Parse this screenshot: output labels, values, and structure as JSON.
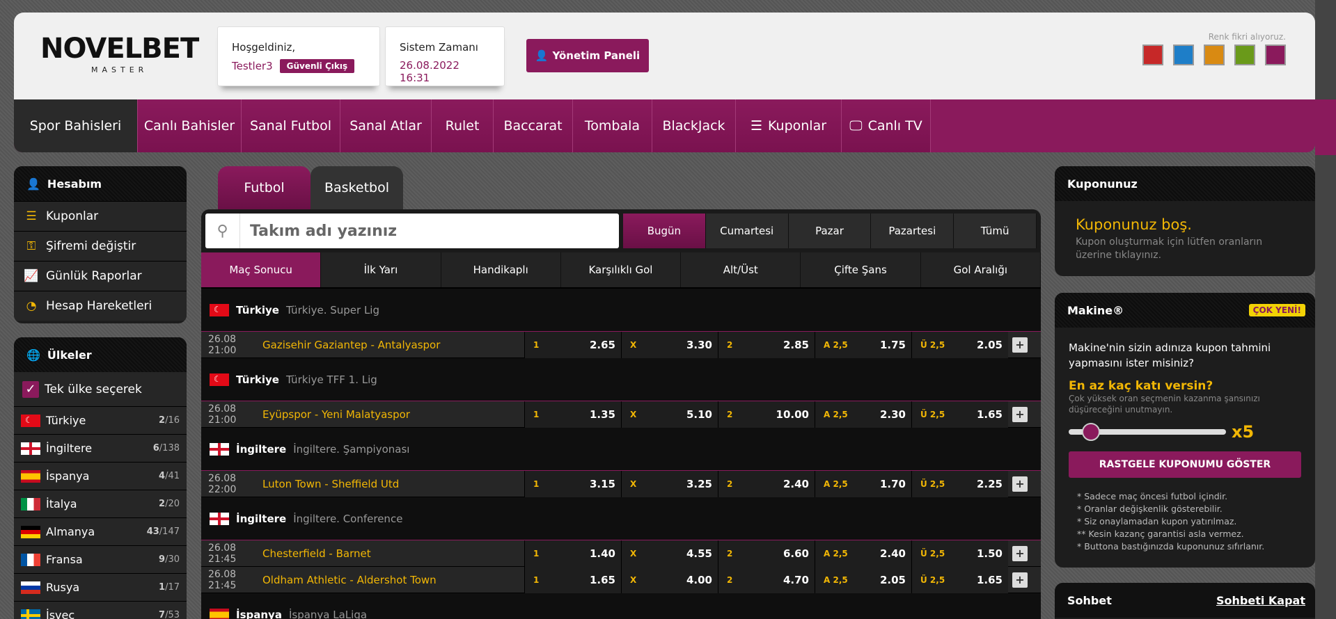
{
  "brand": {
    "name": "NOVELBET",
    "sub": "MASTER"
  },
  "header": {
    "welcome_label": "Hoşgeldiniz,",
    "username": "Testler3",
    "logout": "Güvenli Çıkış",
    "time_label": "Sistem Zamanı",
    "time_value": "26.08.2022 16:31",
    "panel_button": "Yönetim Paneli",
    "color_label": "Renk fikri alıyoruz.",
    "swatches": [
      "#c62828",
      "#1e7ec8",
      "#d98a12",
      "#6a9a1a",
      "#8a1a5c"
    ]
  },
  "nav": [
    {
      "label": "Spor Bahisleri",
      "active": true
    },
    {
      "label": "Canlı Bahisler"
    },
    {
      "label": "Sanal Futbol"
    },
    {
      "label": "Sanal Atlar"
    },
    {
      "label": "Rulet"
    },
    {
      "label": "Baccarat"
    },
    {
      "label": "Tombala"
    },
    {
      "label": "BlackJack"
    },
    {
      "label": "Kuponlar"
    },
    {
      "label": "Canlı TV"
    }
  ],
  "account": {
    "title": "Hesabım",
    "items": [
      "Kuponlar",
      "Şifremi değiştir",
      "Günlük Raporlar",
      "Hesap Hareketleri"
    ]
  },
  "countries": {
    "title": "Ülkeler",
    "single_select": "Tek ülke seçerek",
    "list": [
      {
        "name": "Türkiye",
        "a": "2",
        "b": "/16"
      },
      {
        "name": "İngiltere",
        "a": "6",
        "b": "/138"
      },
      {
        "name": "İspanya",
        "a": "4",
        "b": "/41"
      },
      {
        "name": "İtalya",
        "a": "2",
        "b": "/20"
      },
      {
        "name": "Almanya",
        "a": "43",
        "b": "/147"
      },
      {
        "name": "Fransa",
        "a": "9",
        "b": "/30"
      },
      {
        "name": "Rusya",
        "a": "1",
        "b": "/17"
      },
      {
        "name": "İsveç",
        "a": "7",
        "b": "/53"
      }
    ]
  },
  "sports": [
    "Futbol",
    "Basketbol"
  ],
  "search": {
    "placeholder": "Takım adı yazınız"
  },
  "days": [
    "Bugün",
    "Cumartesi",
    "Pazar",
    "Pazartesi",
    "Tümü"
  ],
  "markets": [
    "Maç Sonucu",
    "İlk Yarı",
    "Handikaplı",
    "Karşılıklı Gol",
    "Alt/Üst",
    "Çifte Şans",
    "Gol Aralığı"
  ],
  "odd_keys": [
    "1",
    "X",
    "2",
    "A 2,5",
    "Ü 2,5"
  ],
  "leagues": [
    {
      "country": "Türkiye",
      "name": "Türkiye. Super Lig",
      "matches": [
        {
          "time": "26.08 21:00",
          "teams": "Gazisehir Gaziantep - Antalyaspor",
          "odds": [
            "2.65",
            "3.30",
            "2.85",
            "1.75",
            "2.05"
          ]
        }
      ]
    },
    {
      "country": "Türkiye",
      "name": "Türkiye TFF 1. Lig",
      "matches": [
        {
          "time": "26.08 21:00",
          "teams": "Eyüpspor - Yeni Malatyaspor",
          "odds": [
            "1.35",
            "5.10",
            "10.00",
            "2.30",
            "1.65"
          ]
        }
      ]
    },
    {
      "country": "İngiltere",
      "name": "İngiltere. Şampiyonası",
      "matches": [
        {
          "time": "26.08 22:00",
          "teams": "Luton Town - Sheffield Utd",
          "odds": [
            "3.15",
            "3.25",
            "2.40",
            "1.70",
            "2.25"
          ]
        }
      ]
    },
    {
      "country": "İngiltere",
      "name": "İngiltere. Conference",
      "matches": [
        {
          "time": "26.08 21:45",
          "teams": "Chesterfield - Barnet",
          "odds": [
            "1.40",
            "4.55",
            "6.60",
            "2.40",
            "1.50"
          ]
        },
        {
          "time": "26.08 21:45",
          "teams": "Oldham Athletic - Aldershot Town",
          "odds": [
            "1.65",
            "4.00",
            "4.70",
            "2.05",
            "1.65"
          ]
        }
      ]
    },
    {
      "country": "İspanya",
      "name": "İspanya LaLiga",
      "matches": []
    }
  ],
  "coupon": {
    "title": "Kuponunuz",
    "empty_title": "Kuponunuz boş.",
    "empty_sub": "Kupon oluşturmak için lütfen oranların üzerine tıklayınız."
  },
  "machine": {
    "title": "Makine®",
    "badge": "ÇOK YENİ!",
    "question": "Makine'nin sizin adınıza kupon tahmini yapmasını ister misiniz?",
    "how_many": "En az kaç katı versin?",
    "warning": "Çok yüksek oran seçmenin kazanma şansınızı düşüreceğini unutmayın.",
    "multiplier": "x5",
    "multiplier_fraction": 0.1,
    "random_button": "RASTGELE KUPONUMU GÖSTER",
    "notes": [
      "* Sadece maç öncesi futbol içindir.",
      "* Oranlar değişkenlik gösterebilir.",
      "* Siz onaylamadan kupon yatırılmaz.",
      "** Kesin kazanç garantisi asla vermez.",
      "* Buttona bastığınızda kuponunuz sıfırlanır."
    ]
  },
  "chat": {
    "title": "Sohbet",
    "close": "Sohbeti Kapat"
  }
}
